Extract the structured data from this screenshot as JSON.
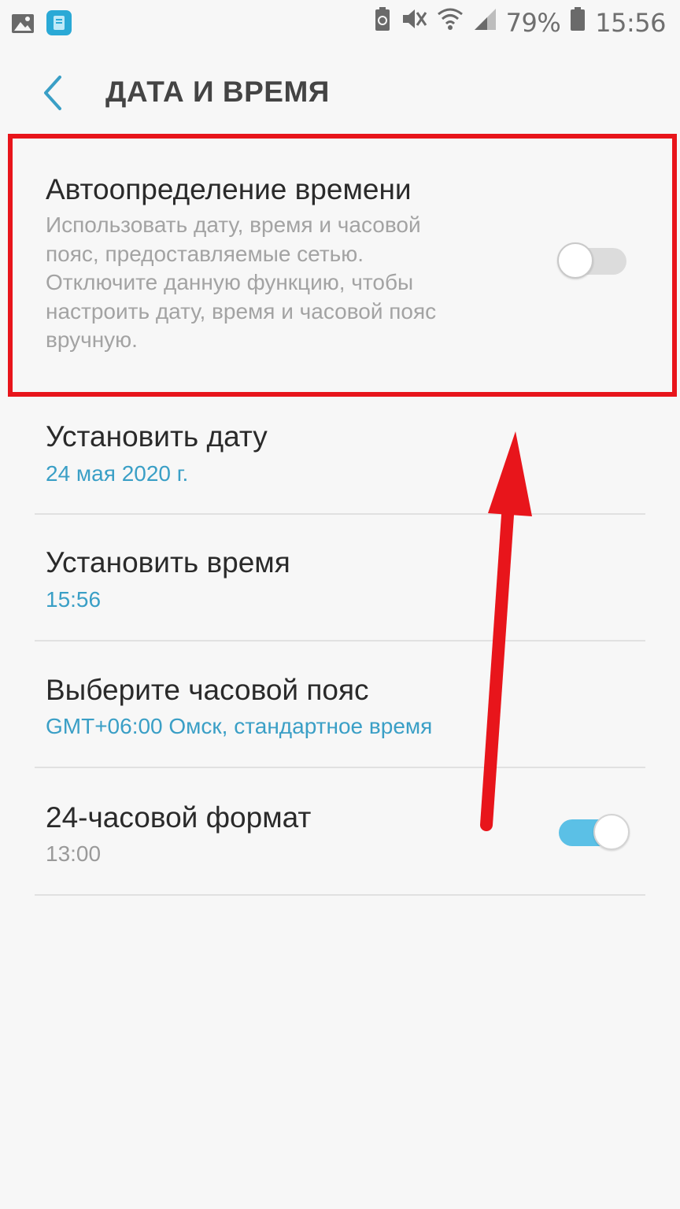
{
  "status_bar": {
    "battery_percent": "79%",
    "time": "15:56",
    "icons": [
      "gallery-icon",
      "app-icon",
      "battery-saver-icon",
      "mute-icon",
      "wifi-icon",
      "signal-icon",
      "battery-icon"
    ]
  },
  "header": {
    "title": "ДАТА И ВРЕМЯ"
  },
  "auto_time": {
    "title": "Автоопределение времени",
    "desc_lines": [
      "Использовать дату, время и часовой",
      "пояс, предоставляемые сетью.",
      "Отключите данную функцию, чтобы",
      "настроить дату, время и часовой пояс",
      "вручную."
    ],
    "enabled": false
  },
  "set_date": {
    "title": "Установить дату",
    "value": "24 мая 2020 г."
  },
  "set_time": {
    "title": "Установить время",
    "value": "15:56"
  },
  "timezone": {
    "title": "Выберите часовой пояс",
    "value": "GMT+06:00 Омск, стандартное время"
  },
  "format24": {
    "title": "24-часовой формат",
    "value": "13:00",
    "enabled": true
  },
  "colors": {
    "accent": "#3a9fc6",
    "toggle_on": "#5bc0e6",
    "annotation_red": "#e8151b"
  }
}
